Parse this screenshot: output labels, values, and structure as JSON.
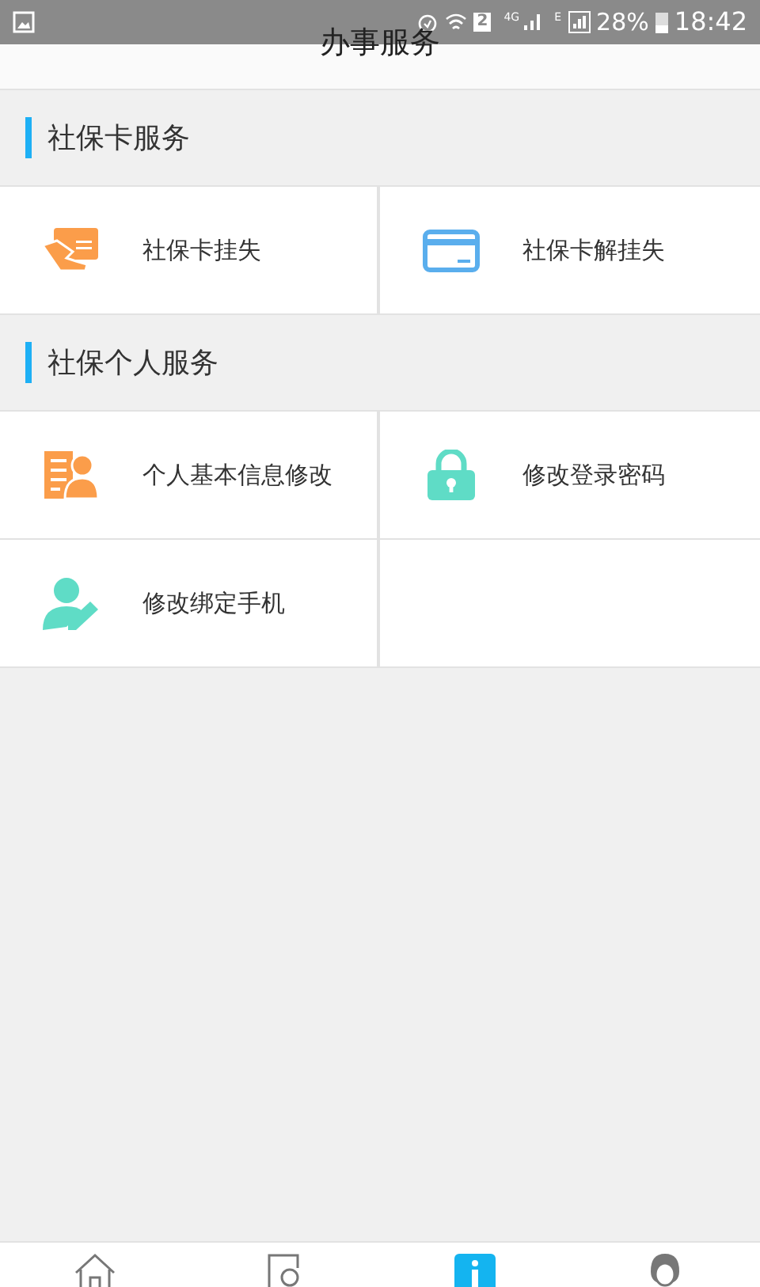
{
  "status_bar": {
    "sim": "2",
    "network_1": "4G",
    "network_2": "E",
    "battery": "28%",
    "time": "18:42"
  },
  "header": {
    "title": "办事服务"
  },
  "sections": [
    {
      "title": "社保卡服务",
      "items": [
        {
          "label": "社保卡挂失",
          "kind": "hand-card"
        },
        {
          "label": "社保卡解挂失",
          "kind": "card"
        }
      ]
    },
    {
      "title": "社保个人服务",
      "items": [
        {
          "label": "个人基本信息修改",
          "kind": "profile"
        },
        {
          "label": "修改登录密码",
          "kind": "lock"
        },
        {
          "label": "修改绑定手机",
          "kind": "user-edit"
        }
      ]
    }
  ],
  "bottom_nav": [
    {
      "kind": "home",
      "selected": false
    },
    {
      "kind": "search",
      "selected": false
    },
    {
      "kind": "info",
      "selected": true
    },
    {
      "kind": "person",
      "selected": false
    }
  ]
}
